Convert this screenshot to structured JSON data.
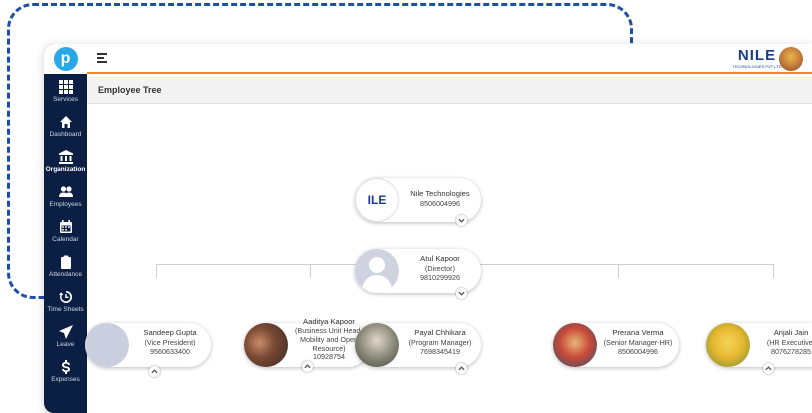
{
  "header": {
    "brand_text": "NILE",
    "brand_sub": "TECHNOLOGIES PVT LTD",
    "page_title": "Employee Tree"
  },
  "sidebar": {
    "items": [
      {
        "label": "Services",
        "icon": "grid-icon"
      },
      {
        "label": "Dashboard",
        "icon": "home-icon"
      },
      {
        "label": "Organization",
        "icon": "bank-icon",
        "active": true
      },
      {
        "label": "Employees",
        "icon": "users-icon"
      },
      {
        "label": "Calendar",
        "icon": "calendar-icon"
      },
      {
        "label": "Attendance",
        "icon": "clipboard-icon"
      },
      {
        "label": "Time Sheets",
        "icon": "history-icon"
      },
      {
        "label": "Leave",
        "icon": "send-icon"
      },
      {
        "label": "Expenses",
        "icon": "money-icon"
      }
    ]
  },
  "tree": {
    "root": {
      "name": "Nile Technologies",
      "phone": "8506004996"
    },
    "director": {
      "name": "Atul Kapoor",
      "role": "(Director)",
      "phone": "9810299926"
    },
    "reports": [
      {
        "name": "Sandeep Gupta",
        "role": "(Vice President)",
        "phone": "9560633400"
      },
      {
        "name": "Aaditya Kapoor",
        "role": "(Business Unit Head-Mobility and Open Resource)",
        "phone": "10928754"
      },
      {
        "name": "Payal Chhikara",
        "role": "(Program Manager)",
        "phone": "7698345419"
      },
      {
        "name": "Prerana Verma",
        "role": "(Senior Manager-HR)",
        "phone": "8506004996"
      },
      {
        "name": "Anjali Jain",
        "role": "(HR Executive)",
        "phone": "8076278285"
      }
    ]
  },
  "colors": {
    "sidebar_bg": "#0b1f44",
    "accent_orange": "#f08a24",
    "brand_blue": "#1b3a8c",
    "frame_dash": "#1f4fa3"
  }
}
